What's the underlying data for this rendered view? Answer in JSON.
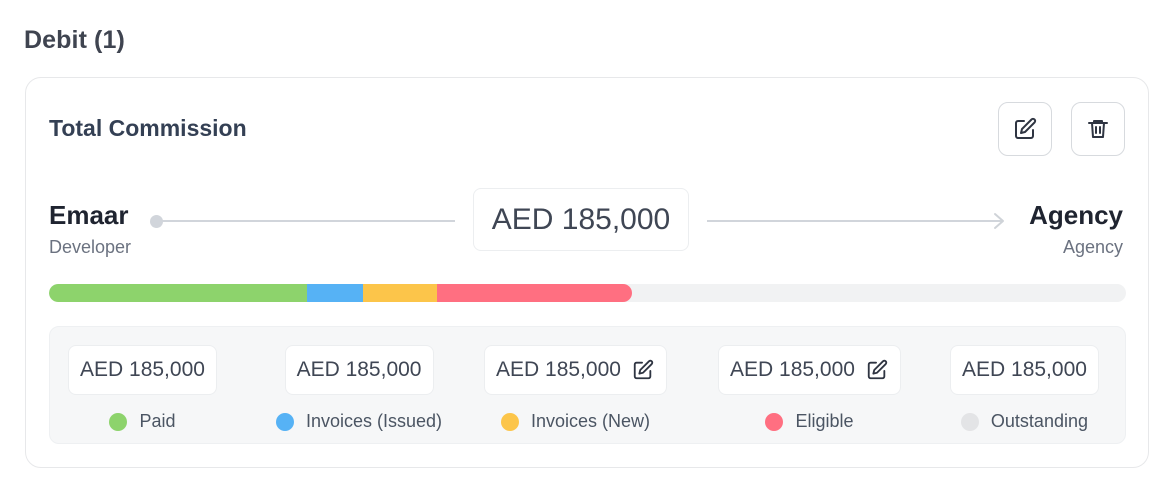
{
  "section": {
    "title": "Debit (1)"
  },
  "card": {
    "title": "Total Commission",
    "edit_icon": "edit-icon",
    "delete_icon": "trash-icon"
  },
  "flow": {
    "from": {
      "name": "Emaar",
      "role": "Developer"
    },
    "to": {
      "name": "Agency",
      "role": "Agency"
    },
    "total": "AED 185,000"
  },
  "progress": {
    "paid": 0.24,
    "invoices_issued": 0.052,
    "invoices_new": 0.068,
    "eligible": 0.181
  },
  "summary": [
    {
      "value": "AED 185,000",
      "label": "Paid",
      "color": "#8dd36c",
      "editable": false
    },
    {
      "value": "AED 185,000",
      "label": "Invoices (Issued)",
      "color": "#56b2f5",
      "editable": false
    },
    {
      "value": "AED 185,000",
      "label": "Invoices (New)",
      "color": "#fcc54a",
      "editable": true
    },
    {
      "value": "AED 185,000",
      "label": "Eligible",
      "color": "#ff6f81",
      "editable": true
    },
    {
      "value": "AED 185,000",
      "label": "Outstanding",
      "color": "#e3e4e6",
      "editable": false
    }
  ]
}
